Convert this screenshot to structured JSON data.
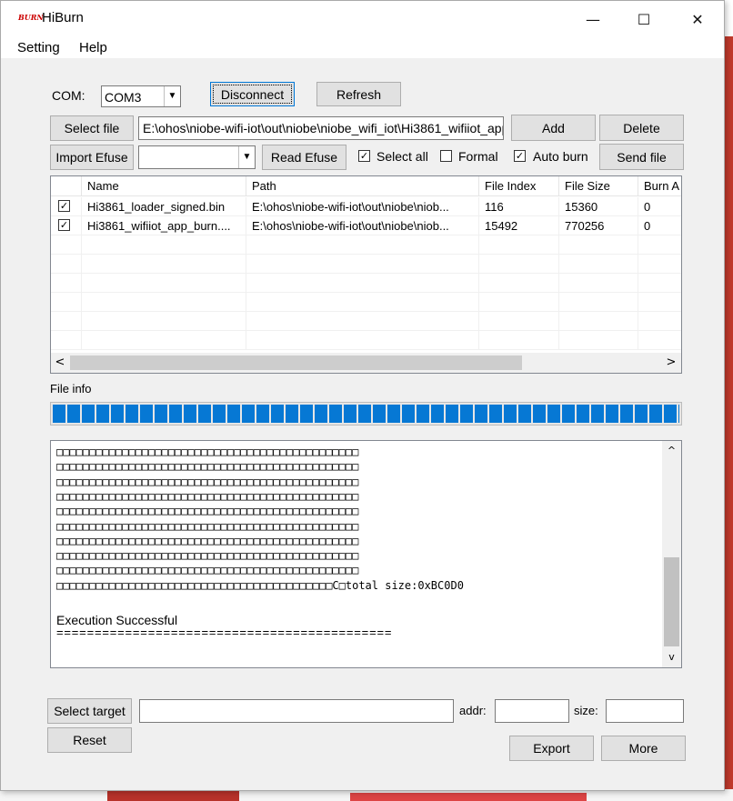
{
  "window": {
    "title": "HiBurn",
    "icon_text": "BURN"
  },
  "caption_buttons": {
    "minimize": "—",
    "maximize": "☐",
    "close": "✕"
  },
  "menu": [
    "Setting",
    "Help"
  ],
  "com": {
    "label": "COM:",
    "value": "COM3"
  },
  "buttons": {
    "disconnect": "Disconnect",
    "refresh": "Refresh",
    "select_file": "Select file",
    "add": "Add",
    "delete": "Delete",
    "import_efuse": "Import Efuse",
    "read_efuse": "Read Efuse",
    "send_file": "Send file",
    "select_target": "Select target",
    "reset": "Reset",
    "export": "Export",
    "more": "More"
  },
  "file_path": "E:\\ohos\\niobe-wifi-iot\\out\\niobe\\niobe_wifi_iot\\Hi3861_wifiiot_app",
  "efuse_select": "",
  "checkboxes": {
    "select_all": {
      "label": "Select all",
      "checked": true
    },
    "formal": {
      "label": "Formal",
      "checked": false
    },
    "auto_burn": {
      "label": "Auto burn",
      "checked": true
    }
  },
  "table": {
    "columns": [
      "Name",
      "Path",
      "File Index",
      "File Size",
      "Burn A"
    ],
    "rows": [
      {
        "checked": true,
        "name": "Hi3861_loader_signed.bin",
        "path": "E:\\ohos\\niobe-wifi-iot\\out\\niobe\\niob...",
        "index": "116",
        "size": "15360",
        "burn": "0"
      },
      {
        "checked": true,
        "name": "Hi3861_wifiiot_app_burn....",
        "path": "E:\\ohos\\niobe-wifi-iot\\out\\niobe\\niob...",
        "index": "15492",
        "size": "770256",
        "burn": "0"
      }
    ],
    "scroll_left": "<",
    "scroll_right": ">"
  },
  "file_info_label": "File info",
  "progress": {
    "fraction": 1.0
  },
  "log": {
    "box_line": "□□□□□□□□□□□□□□□□□□□□□□□□□□□□□□□□□□□□□□□□□□□□□□",
    "last_box_line": "□□□□□□□□□□□□□□□□□□□□□□□□□□□□□□□□□□□□□□□□□□C□total size:0xBC0D0",
    "result": "Execution Successful",
    "separator": "============================================",
    "scroll_up": "^",
    "scroll_down": "v"
  },
  "target": {
    "value": "",
    "addr_label": "addr:",
    "addr_value": "",
    "size_label": "size:",
    "size_value": ""
  },
  "colors": {
    "progress": "#0678d4",
    "window_bg": "#f0f0f0"
  }
}
